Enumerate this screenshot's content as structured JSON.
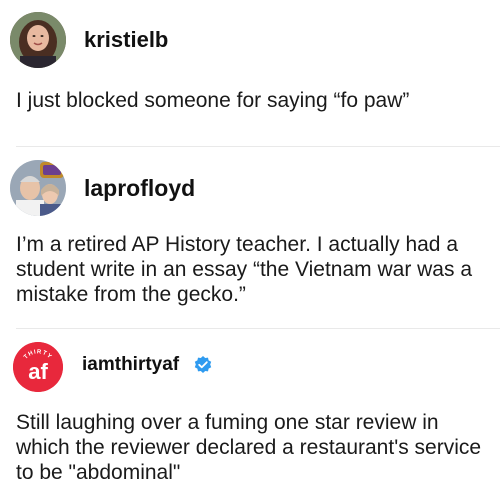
{
  "posts": [
    {
      "username": "kristielb",
      "avatar_icon": "profile-photo-woman",
      "text": "I just blocked someone for saying “fo paw”"
    },
    {
      "username": "laprofloyd",
      "avatar_icon": "profile-photo-couple",
      "text": "I’m a retired AP History teacher. I actually had a student write in an essay “the Vietnam war was a mistake from the gecko.”"
    },
    {
      "username": "iamthirtyaf",
      "avatar_icon": "thirty-af-logo",
      "avatar_badge_text": "af",
      "avatar_arc_text": "THIRTY",
      "verified_icon": "verified-badge-icon",
      "text": "Still laughing over a fuming one star review in which the reviewer declared a restaurant's service to be \"abdominal\""
    }
  ],
  "colors": {
    "brand_red": "#e8283c",
    "verified_blue": "#2f9bf0",
    "text": "#111111"
  }
}
